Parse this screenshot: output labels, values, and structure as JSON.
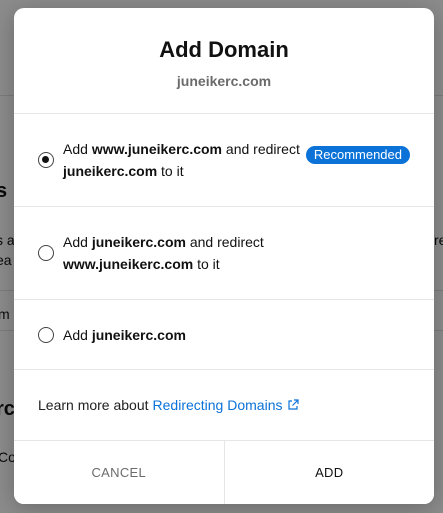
{
  "background": {
    "fragments": [
      "s",
      "s a",
      "ea",
      "re",
      "m",
      "rc",
      "Co"
    ]
  },
  "modal": {
    "title": "Add Domain",
    "subtitle": "juneikerc.com",
    "options": [
      {
        "selected": true,
        "parts": [
          "Add ",
          "www.juneikerc.com",
          " and redirect ",
          "juneikerc.com",
          " to it"
        ],
        "badge": "Recommended"
      },
      {
        "selected": false,
        "parts": [
          "Add ",
          "juneikerc.com",
          " and redirect ",
          "www.juneikerc.com",
          " to it"
        ]
      },
      {
        "selected": false,
        "parts": [
          "Add ",
          "juneikerc.com"
        ]
      }
    ],
    "learn_more": {
      "text": "Learn more about",
      "link": "Redirecting Domains",
      "icon": "external-link-icon"
    },
    "footer": {
      "cancel_label": "CANCEL",
      "add_label": "ADD"
    }
  },
  "colors": {
    "accent": "#0b72d8",
    "overlay": "rgba(0,0,0,0.45)"
  }
}
